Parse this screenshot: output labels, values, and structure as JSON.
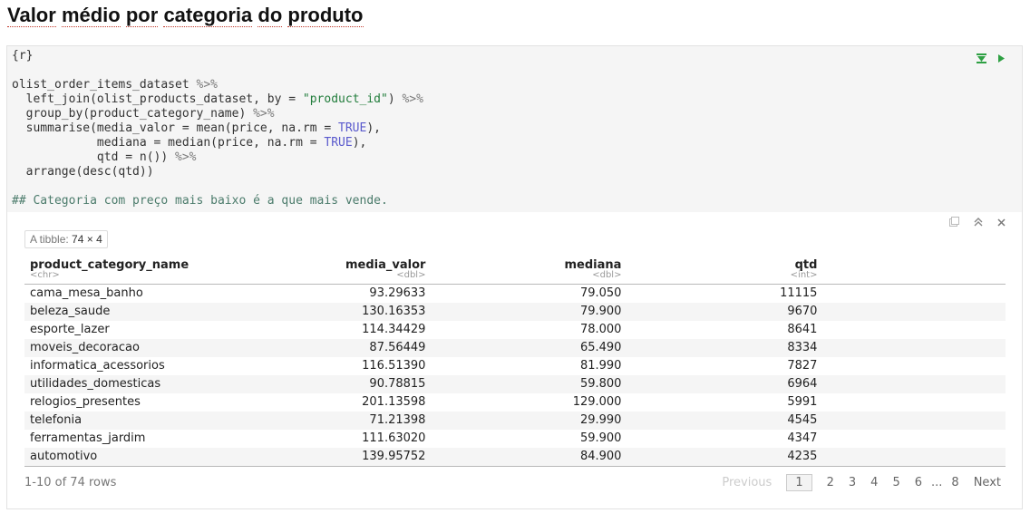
{
  "heading": {
    "words": [
      "Valor",
      "médio",
      "por",
      "categoria",
      "do",
      "produto"
    ]
  },
  "code": {
    "header": "{r}",
    "lines": {
      "l1": "olist_order_items_dataset",
      "l2a": "  left_join(olist_products_dataset, by = ",
      "l2s": "\"product_id\"",
      "l2b": ") ",
      "l3": "  group_by(product_category_name) ",
      "l4a": "  summarise(media_valor = mean(price, na.rm = ",
      "l4k": "TRUE",
      "l4b": "),",
      "l5a": "            mediana = median(price, na.rm = ",
      "l5k": "TRUE",
      "l5b": "),",
      "l6": "            qtd = n()) ",
      "l7": "  arrange(desc(qtd))",
      "comment": "## Categoria com preço mais baixo é a que mais vende."
    },
    "pipe": "%>%"
  },
  "output": {
    "tibble_prefix": "A tibble:",
    "tibble_dims": "74 × 4",
    "columns": [
      {
        "name": "product_category_name",
        "type": "<chr>"
      },
      {
        "name": "media_valor",
        "type": "<dbl>"
      },
      {
        "name": "mediana",
        "type": "<dbl>"
      },
      {
        "name": "qtd",
        "type": "<int>"
      }
    ],
    "rows": [
      [
        "cama_mesa_banho",
        "93.29633",
        "79.050",
        "11115"
      ],
      [
        "beleza_saude",
        "130.16353",
        "79.900",
        "9670"
      ],
      [
        "esporte_lazer",
        "114.34429",
        "78.000",
        "8641"
      ],
      [
        "moveis_decoracao",
        "87.56449",
        "65.490",
        "8334"
      ],
      [
        "informatica_acessorios",
        "116.51390",
        "81.990",
        "7827"
      ],
      [
        "utilidades_domesticas",
        "90.78815",
        "59.800",
        "6964"
      ],
      [
        "relogios_presentes",
        "201.13598",
        "129.000",
        "5991"
      ],
      [
        "telefonia",
        "71.21398",
        "29.990",
        "4545"
      ],
      [
        "ferramentas_jardim",
        "111.63020",
        "59.900",
        "4347"
      ],
      [
        "automotivo",
        "139.95752",
        "84.900",
        "4235"
      ]
    ],
    "rows_info": "1-10 of 74 rows",
    "pagination": {
      "previous": "Previous",
      "pages": [
        "1",
        "2",
        "3",
        "4",
        "5",
        "6"
      ],
      "ellipsis": "...",
      "last": "8",
      "next": "Next",
      "current": "1"
    }
  },
  "icons": {
    "code": [
      "run-above-icon",
      "run-chunk-icon"
    ],
    "output": [
      "expand-output-icon",
      "collapse-output-icon",
      "clear-output-icon"
    ]
  }
}
